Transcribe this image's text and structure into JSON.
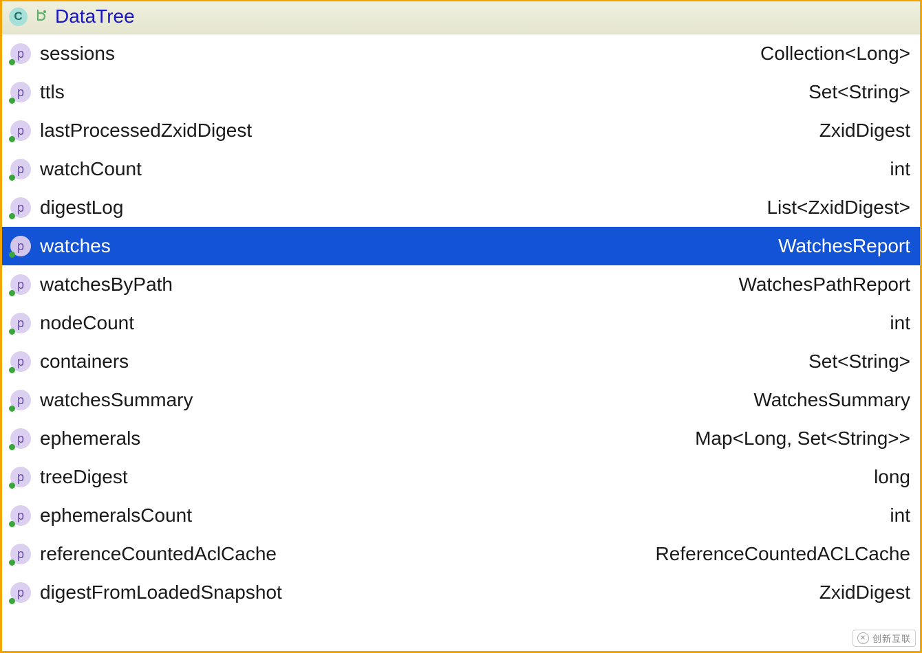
{
  "header": {
    "icon_letter": "C",
    "title": "DataTree"
  },
  "rows": [
    {
      "icon_letter": "p",
      "name": "sessions",
      "type": "Collection<Long>",
      "selected": false
    },
    {
      "icon_letter": "p",
      "name": "ttls",
      "type": "Set<String>",
      "selected": false
    },
    {
      "icon_letter": "p",
      "name": "lastProcessedZxidDigest",
      "type": "ZxidDigest",
      "selected": false
    },
    {
      "icon_letter": "p",
      "name": "watchCount",
      "type": "int",
      "selected": false
    },
    {
      "icon_letter": "p",
      "name": "digestLog",
      "type": "List<ZxidDigest>",
      "selected": false
    },
    {
      "icon_letter": "p",
      "name": "watches",
      "type": "WatchesReport",
      "selected": true
    },
    {
      "icon_letter": "p",
      "name": "watchesByPath",
      "type": "WatchesPathReport",
      "selected": false
    },
    {
      "icon_letter": "p",
      "name": "nodeCount",
      "type": "int",
      "selected": false
    },
    {
      "icon_letter": "p",
      "name": "containers",
      "type": "Set<String>",
      "selected": false
    },
    {
      "icon_letter": "p",
      "name": "watchesSummary",
      "type": "WatchesSummary",
      "selected": false
    },
    {
      "icon_letter": "p",
      "name": "ephemerals",
      "type": "Map<Long, Set<String>>",
      "selected": false
    },
    {
      "icon_letter": "p",
      "name": "treeDigest",
      "type": "long",
      "selected": false
    },
    {
      "icon_letter": "p",
      "name": "ephemeralsCount",
      "type": "int",
      "selected": false
    },
    {
      "icon_letter": "p",
      "name": "referenceCountedAclCache",
      "type": "ReferenceCountedACLCache",
      "selected": false
    },
    {
      "icon_letter": "p",
      "name": "digestFromLoadedSnapshot",
      "type": "ZxidDigest",
      "selected": false
    }
  ],
  "watermark": {
    "text": "创新互联"
  }
}
